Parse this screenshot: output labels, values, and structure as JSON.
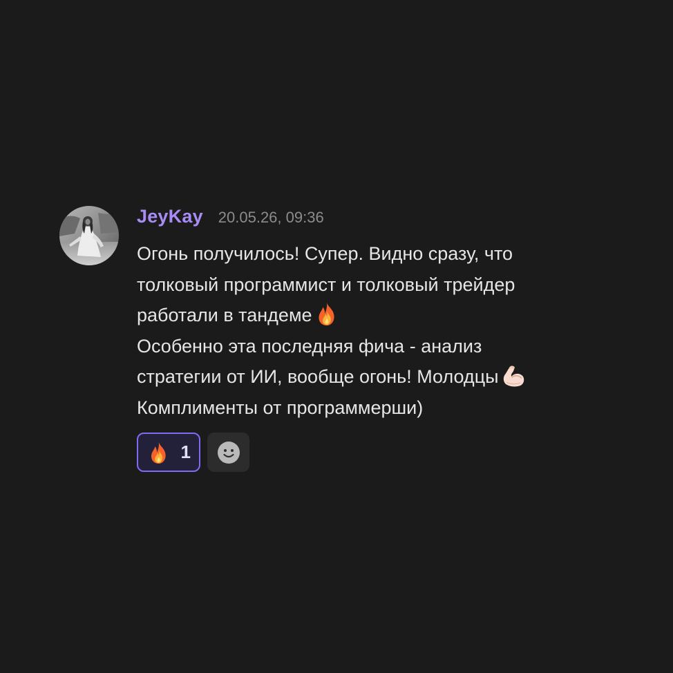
{
  "message": {
    "author": "JeyKay",
    "timestamp": "20.05.26, 09:36",
    "lines": [
      "Огонь получилось! Супер. Видно сразу, что",
      "толковый программист и толковый трейдер",
      "работали в тандеме",
      "Особенно эта последняя фича - анализ",
      "стратегии от ИИ, вообще огонь! Молодцы",
      "Комплименты от программерши)"
    ],
    "inline_emojis": {
      "line_3": "fire-emoji",
      "line_5": "flexed-biceps-emoji"
    }
  },
  "reactions": [
    {
      "emoji": "fire-emoji",
      "count": "1",
      "selected": true
    }
  ],
  "add_reaction": {
    "icon": "smiley-icon"
  },
  "colors": {
    "background": "#1b1b1b",
    "username": "#a88bf5",
    "timestamp": "#8c8c8c",
    "text": "#e6e6e6",
    "reaction_border": "#7f6cf2",
    "add_button_bg": "#2c2c2c"
  }
}
